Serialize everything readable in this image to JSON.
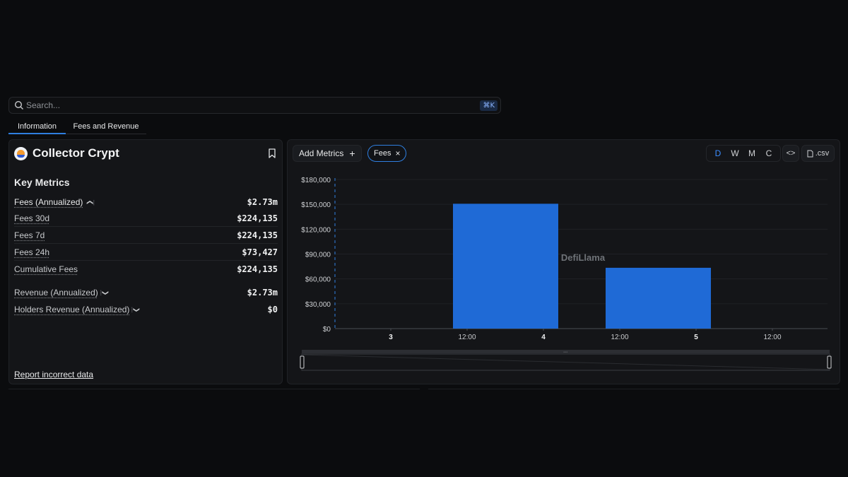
{
  "search": {
    "placeholder": "Search...",
    "shortcut": "⌘K"
  },
  "tabs": [
    {
      "label": "Information"
    },
    {
      "label": "Fees and Revenue"
    }
  ],
  "protocol": {
    "name": "Collector Crypt"
  },
  "key_metrics": {
    "title": "Key Metrics",
    "rows": [
      {
        "label": "Fees (Annualized)",
        "value": "$2.73m",
        "chevron": "^"
      },
      {
        "label": "Fees 30d",
        "value": "$224,135"
      },
      {
        "label": "Fees 7d",
        "value": "$224,135"
      },
      {
        "label": "Fees 24h",
        "value": "$73,427"
      },
      {
        "label": "Cumulative Fees",
        "value": "$224,135"
      },
      {
        "label": "Revenue (Annualized)",
        "value": "$2.73m",
        "chevron": "v"
      },
      {
        "label": "Holders Revenue (Annualized)",
        "value": "$0",
        "chevron": "v"
      }
    ]
  },
  "report_link": "Report incorrect data",
  "chart_toolbar": {
    "add_metrics": "Add Metrics",
    "add_icon": "+",
    "active_metric": "Fees",
    "remove_icon": "×",
    "periods": [
      "D",
      "W",
      "M",
      "C"
    ],
    "active_period": "D",
    "embed_label": "<>",
    "csv_label": ".csv"
  },
  "watermark": "DefiLlama",
  "colors": {
    "bar": "#1f6ad6",
    "accent": "#2f7fe0",
    "background": "#0b0c0e",
    "panel": "#141518"
  },
  "chart_data": {
    "type": "bar",
    "x_ticks": [
      "3",
      "12:00",
      "4",
      "12:00",
      "5",
      "12:00"
    ],
    "x_ticks_bold": [
      "3",
      "4",
      "5"
    ],
    "series": [
      {
        "values": [
          {
            "x": "4",
            "y": 150708
          },
          {
            "x": "5",
            "y": 73427
          }
        ]
      }
    ],
    "y_ticks": [
      "$0",
      "$30,000",
      "$60,000",
      "$90,000",
      "$120,000",
      "$150,000",
      "$180,000"
    ],
    "ylim": [
      0,
      180000
    ],
    "grid": true
  }
}
